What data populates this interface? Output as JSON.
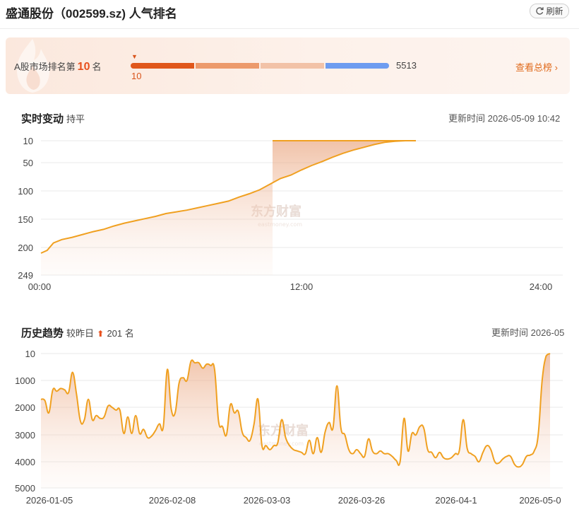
{
  "header": {
    "title": "盛通股份（002599.sz) 人气排名",
    "refresh_label": "刷新"
  },
  "rank_banner": {
    "prefix": "A股市场排名第",
    "rank": "10",
    "suffix": "名",
    "bar_min": "10",
    "bar_max": "5513",
    "view_all": "查看总榜",
    "segment_colors": [
      "#e0571b",
      "#ec9a6c",
      "#f2c2a7",
      "#6d9cf0"
    ]
  },
  "realtime": {
    "title": "实时变动",
    "status": "持平",
    "update_time": "更新时间 2026-05-09 10:42"
  },
  "history": {
    "title": "历史趋势",
    "compare_label": "较昨日",
    "compare_arrow": "⬆",
    "compare_value": "201 名",
    "update_time": "更新时间 2026-05"
  },
  "watermark": {
    "cn": "东方财富",
    "en": "eastmoney.com"
  },
  "chart_data": [
    {
      "type": "area",
      "title": "实时变动",
      "y_inverted": true,
      "ylim": [
        249,
        10
      ],
      "y_ticks": [
        "10",
        "50",
        "100",
        "150",
        "200",
        "249"
      ],
      "x_ticks": [
        "00:00",
        "12:00",
        "24:00"
      ],
      "x_range_hours": [
        0,
        24
      ],
      "color": "#f0a020",
      "points": [
        [
          0,
          210
        ],
        [
          0.3,
          205
        ],
        [
          0.6,
          192
        ],
        [
          1,
          186
        ],
        [
          1.5,
          182
        ],
        [
          2,
          177
        ],
        [
          2.5,
          172
        ],
        [
          3,
          168
        ],
        [
          3.5,
          162
        ],
        [
          4,
          157
        ],
        [
          4.5,
          153
        ],
        [
          5,
          149
        ],
        [
          5.5,
          145
        ],
        [
          6,
          140
        ],
        [
          6.5,
          137
        ],
        [
          7,
          134
        ],
        [
          7.5,
          130
        ],
        [
          8,
          126
        ],
        [
          8.5,
          122
        ],
        [
          9,
          118
        ],
        [
          9.5,
          111
        ],
        [
          10,
          105
        ],
        [
          10.5,
          98
        ],
        [
          11,
          88
        ],
        [
          11.5,
          78
        ],
        [
          12,
          72
        ],
        [
          12.5,
          63
        ],
        [
          13,
          55
        ],
        [
          13.5,
          48
        ],
        [
          14,
          40
        ],
        [
          14.5,
          33
        ],
        [
          15,
          27
        ],
        [
          15.5,
          22
        ],
        [
          16,
          17
        ],
        [
          16.5,
          13
        ],
        [
          17,
          11
        ],
        [
          17.5,
          10
        ],
        [
          18,
          10
        ]
      ]
    },
    {
      "type": "area",
      "title": "历史趋势",
      "y_inverted": true,
      "ylim": [
        5000,
        10
      ],
      "y_ticks": [
        "10",
        "1000",
        "2000",
        "3000",
        "4000",
        "5000"
      ],
      "x_ticks": [
        "2026-01-05",
        "2026-02-08",
        "2026-03-03",
        "2026-03-26",
        "2026-04-1",
        "2026-05-0"
      ],
      "color": "#f0a020",
      "values": [
        1700,
        1750,
        2200,
        1350,
        1400,
        1300,
        1350,
        1450,
        700,
        1500,
        2500,
        2450,
        1700,
        2450,
        2300,
        2400,
        2350,
        1950,
        2000,
        2100,
        2100,
        2950,
        2350,
        2950,
        2300,
        2950,
        2800,
        3100,
        3050,
        2850,
        2600,
        2700,
        600,
        2050,
        2200,
        1100,
        900,
        1000,
        300,
        350,
        350,
        550,
        400,
        450,
        600,
        2500,
        2700,
        3000,
        1900,
        2200,
        2150,
        2900,
        3100,
        3200,
        2600,
        1700,
        3400,
        3400,
        3550,
        3400,
        3300,
        2450,
        3100,
        3400,
        3550,
        3600,
        3650,
        3700,
        3200,
        3700,
        3100,
        3650,
        2900,
        2550,
        2750,
        1200,
        2750,
        3000,
        3550,
        3700,
        3550,
        3700,
        3800,
        3150,
        3600,
        3700,
        3600,
        3700,
        3700,
        3800,
        3950,
        4000,
        2400,
        3600,
        2950,
        3000,
        2700,
        2750,
        3550,
        3650,
        3850,
        3650,
        3850,
        3900,
        3850,
        3700,
        3600,
        2450,
        3500,
        3700,
        3800,
        4000,
        3650,
        3400,
        3550,
        4000,
        4050,
        3900,
        3800,
        3800,
        4100,
        4200,
        4100,
        3800,
        3750,
        3600,
        3000,
        1000,
        100,
        10
      ],
      "colors_note": "area gradient orange to white"
    }
  ]
}
